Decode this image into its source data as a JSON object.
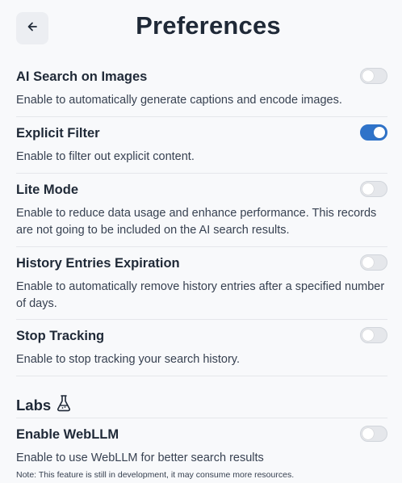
{
  "header": {
    "title": "Preferences",
    "back_icon": "arrow-left-icon"
  },
  "settings": [
    {
      "title": "AI Search on Images",
      "description": "Enable to automatically generate captions and encode images.",
      "enabled": false
    },
    {
      "title": "Explicit Filter",
      "description": "Enable to filter out explicit content.",
      "enabled": true
    },
    {
      "title": "Lite Mode",
      "description": "Enable to reduce data usage and enhance performance. This records are not going to be included on the AI search results.",
      "enabled": false
    },
    {
      "title": "History Entries Expiration",
      "description": "Enable to automatically remove history entries after a specified number of days.",
      "enabled": false
    },
    {
      "title": "Stop Tracking",
      "description": "Enable to stop tracking your search history.",
      "enabled": false
    }
  ],
  "labs": {
    "heading": "Labs",
    "icon": "flask-icon",
    "items": [
      {
        "title": "Enable WebLLM",
        "description": "Enable to use WebLLM for better search results",
        "note": "Note: This feature is still in development, it may consume more resources.",
        "enabled": false
      }
    ]
  },
  "colors": {
    "accent": "#2f73c9",
    "toggle_off": "#e5e7eb",
    "background": "#f8f9fb"
  }
}
